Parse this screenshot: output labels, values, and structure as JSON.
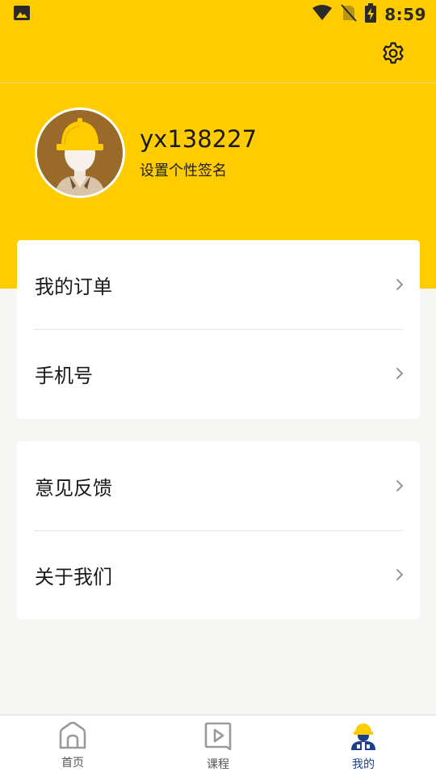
{
  "status_bar": {
    "time": "8:59",
    "icons": [
      "image-icon",
      "wifi-icon",
      "no-sim-icon",
      "battery-charging-icon"
    ]
  },
  "header": {
    "settings_icon": "gear-icon"
  },
  "profile": {
    "username": "yx138227",
    "signature": "设置个性签名",
    "avatar_icon": "construction-worker-avatar"
  },
  "menu": {
    "group1": [
      {
        "label": "我的订单"
      },
      {
        "label": "手机号"
      }
    ],
    "group2": [
      {
        "label": "意见反馈"
      },
      {
        "label": "关于我们"
      }
    ]
  },
  "tabbar": {
    "tabs": [
      {
        "label": "首页",
        "icon": "home-icon",
        "active": false
      },
      {
        "label": "课程",
        "icon": "course-play-icon",
        "active": false
      },
      {
        "label": "我的",
        "icon": "worker-profile-icon",
        "active": true
      }
    ]
  },
  "colors": {
    "header_yellow": "#ffcc00",
    "active_tab": "#1c3f8c",
    "background": "#f6f6f5"
  }
}
